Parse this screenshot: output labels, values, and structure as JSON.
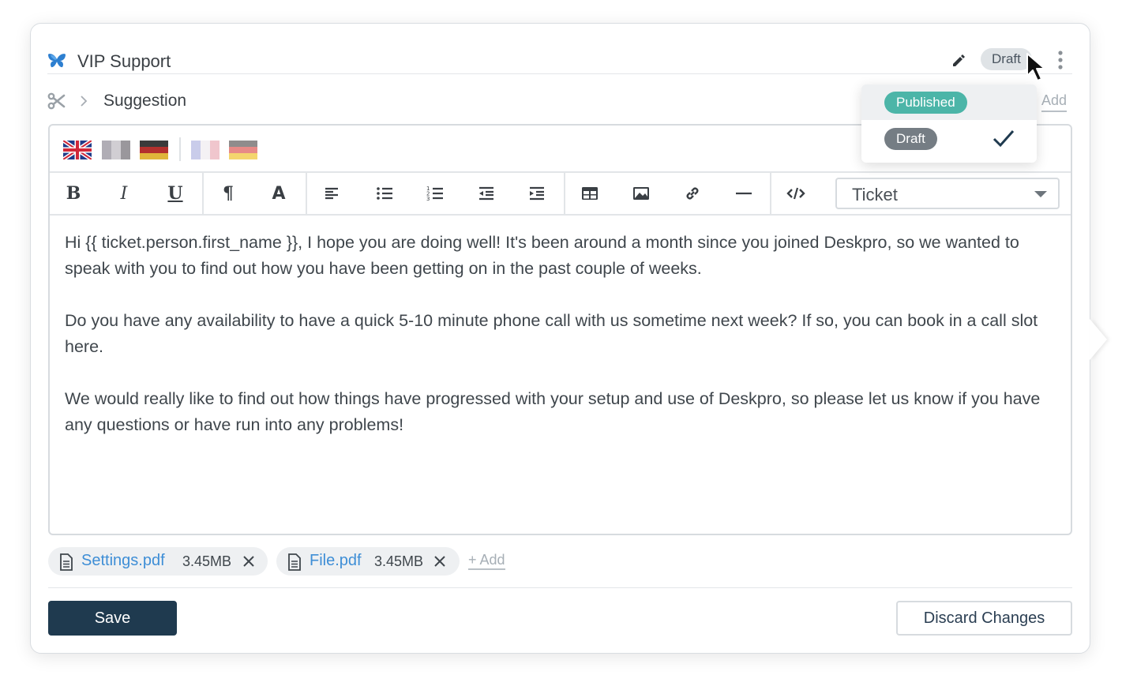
{
  "header": {
    "title": "VIP Support",
    "status_pill": "Draft"
  },
  "breadcrumb": {
    "current": "Suggestion",
    "add_label": "Add"
  },
  "status_menu": {
    "items": [
      {
        "label": "Published",
        "color": "#4cb5a8",
        "selected": false
      },
      {
        "label": "Draft",
        "color": "#757d84",
        "selected": true
      }
    ]
  },
  "languages": [
    "en-gb-flag",
    "grey-flag-1",
    "de-flag",
    "grey-flag-2",
    "de-flag-light"
  ],
  "toolbar": {
    "bold": "B",
    "italic": "I",
    "underline": "U",
    "paragraph": "¶",
    "font": "A",
    "insert_select": "Ticket"
  },
  "content": {
    "paragraphs": [
      "Hi {{ ticket.person.first_name }},  I hope you are doing well! It's been around a month since you joined Deskpro, so we wanted to speak with you to find out how you have been getting on in the past couple of weeks.",
      "Do you have any availability to have a quick 5-10 minute phone call with us sometime next week? If so, you can book in a call slot here.",
      "We would really like to find out how things have progressed with your setup and use of Deskpro, so please let us know if you have any questions or have run into any problems!"
    ]
  },
  "attachments": [
    {
      "name": "Settings.pdf",
      "size": "3.45MB"
    },
    {
      "name": "File.pdf",
      "size": "3.45MB"
    }
  ],
  "attachments_add": "+ Add",
  "actions": {
    "save": "Save",
    "discard": "Discard Changes"
  },
  "colors": {
    "primary": "#1f3a4f",
    "link": "#3e8ed6",
    "published": "#4cb5a8"
  }
}
